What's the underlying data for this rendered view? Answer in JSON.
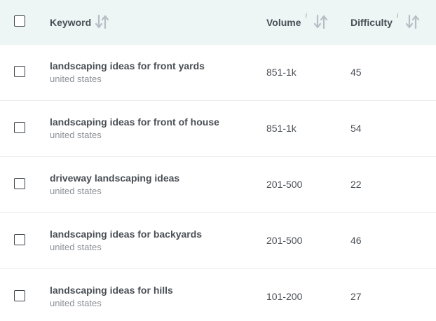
{
  "header": {
    "keyword_label": "Keyword",
    "volume_label": "Volume",
    "volume_info": "i",
    "difficulty_label": "Difficulty",
    "difficulty_info": "i"
  },
  "rows": [
    {
      "keyword": "landscaping ideas for front yards",
      "location": "united states",
      "volume": "851-1k",
      "difficulty": "45"
    },
    {
      "keyword": "landscaping ideas for front of house",
      "location": "united states",
      "volume": "851-1k",
      "difficulty": "54"
    },
    {
      "keyword": "driveway landscaping ideas",
      "location": "united states",
      "volume": "201-500",
      "difficulty": "22"
    },
    {
      "keyword": "landscaping ideas for backyards",
      "location": "united states",
      "volume": "201-500",
      "difficulty": "46"
    },
    {
      "keyword": "landscaping ideas for hills",
      "location": "united states",
      "volume": "101-200",
      "difficulty": "27"
    }
  ],
  "colors": {
    "header_bg": "#edf5f5",
    "text_primary": "#4a4f55",
    "text_secondary": "#8b9197",
    "sort_icon": "#b7bec4"
  }
}
